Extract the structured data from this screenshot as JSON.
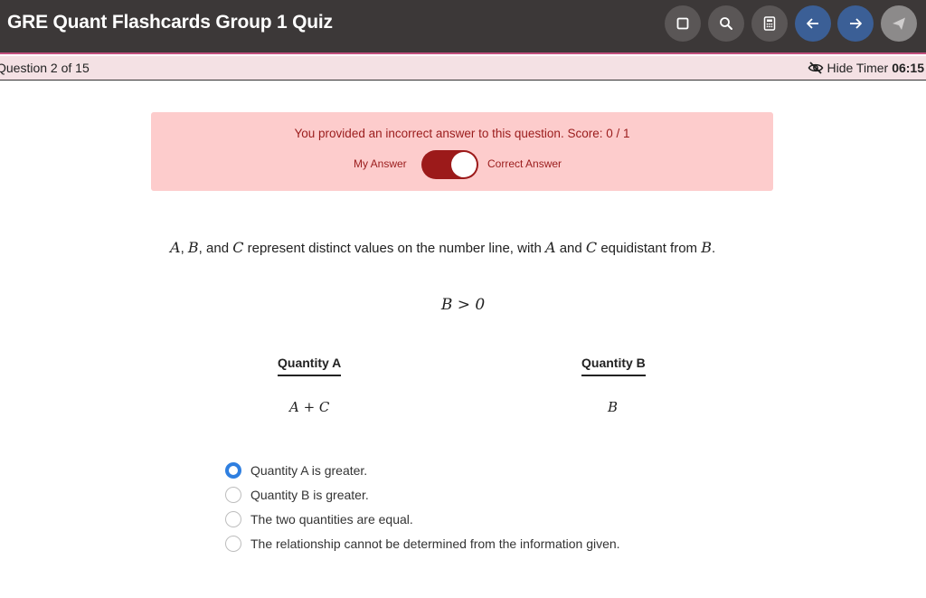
{
  "header": {
    "title": "GRE Quant Flashcards Group 1 Quiz",
    "buttons": [
      {
        "name": "square-icon"
      },
      {
        "name": "search-icon"
      },
      {
        "name": "calculator-icon"
      },
      {
        "name": "arrow-left-icon"
      },
      {
        "name": "arrow-right-icon"
      },
      {
        "name": "send-icon"
      }
    ]
  },
  "statusbar": {
    "question_counter": "Question 2 of 15",
    "timer_label": "Hide Timer",
    "timer_value": "06:15"
  },
  "feedback": {
    "message": "You provided an incorrect answer to this question. Score: 0 / 1",
    "my_answer_label": "My Answer",
    "correct_answer_label": "Correct Answer",
    "toggle_state": "Correct Answer",
    "colors": {
      "background": "#fdcccc",
      "text": "#9a1c1c",
      "toggle": "#9c1a1a"
    }
  },
  "question": {
    "var_a": "A",
    "sep1": ", ",
    "var_b": "B",
    "sep2": ", and ",
    "var_c": "C",
    "text1": " represent distinct values on the number line, with ",
    "var_a2": "A",
    "and_text": " and ",
    "var_c2": "C",
    "text2": " equidistant from ",
    "var_b2": "B",
    "period": ".",
    "condition": "B > 0"
  },
  "quantities": {
    "a_label": "Quantity A",
    "a_value": "A + C",
    "b_label": "Quantity B",
    "b_value": "B"
  },
  "choices": [
    {
      "text": "Quantity A is greater.",
      "selected": true
    },
    {
      "text": "Quantity B is greater.",
      "selected": false
    },
    {
      "text": "The two quantities are equal.",
      "selected": false
    },
    {
      "text": "The relationship cannot be determined from the information given.",
      "selected": false
    }
  ],
  "accent_color": "#2f7fe0"
}
